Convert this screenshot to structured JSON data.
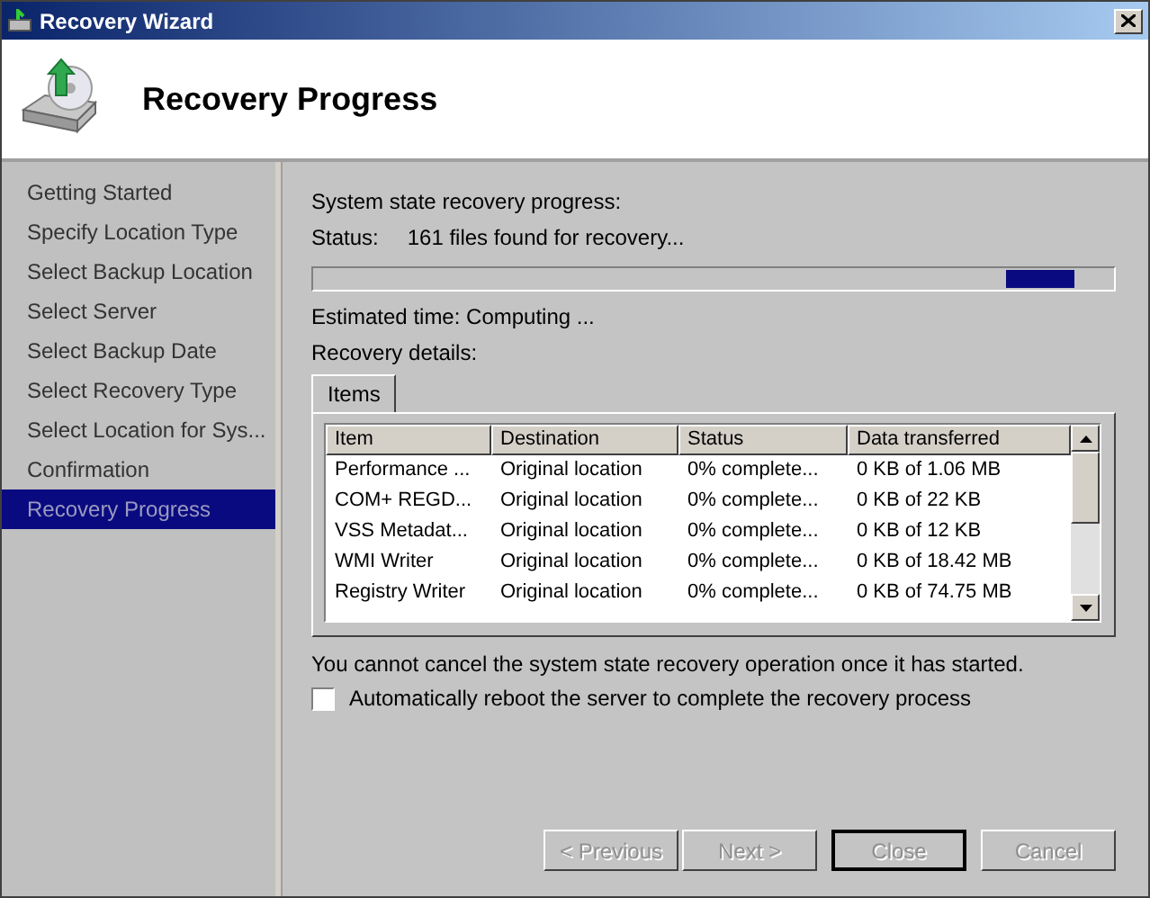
{
  "window": {
    "title": "Recovery Wizard"
  },
  "header": {
    "title": "Recovery Progress"
  },
  "sidebar": {
    "items": [
      {
        "label": "Getting Started",
        "selected": false
      },
      {
        "label": "Specify Location Type",
        "selected": false
      },
      {
        "label": "Select Backup Location",
        "selected": false
      },
      {
        "label": "Select Server",
        "selected": false
      },
      {
        "label": "Select Backup Date",
        "selected": false
      },
      {
        "label": "Select Recovery Type",
        "selected": false
      },
      {
        "label": "Select Location for Sys...",
        "selected": false
      },
      {
        "label": "Confirmation",
        "selected": false
      },
      {
        "label": "Recovery Progress",
        "selected": true
      }
    ]
  },
  "progress": {
    "heading": "System state recovery progress:",
    "status_label": "Status:",
    "status_value": "161 files found for recovery...",
    "estimated": "Estimated time: Computing ...",
    "details_label": "Recovery details:",
    "level": 0.95
  },
  "tabs": [
    {
      "label": "Items",
      "selected": true
    }
  ],
  "table": {
    "columns": [
      "Item",
      "Destination",
      "Status",
      "Data transferred"
    ],
    "rows": [
      [
        "Performance ...",
        "Original location",
        "0% complete...",
        "0 KB of 1.06 MB"
      ],
      [
        "COM+ REGD...",
        "Original location",
        "0% complete...",
        "0 KB of 22 KB"
      ],
      [
        "VSS Metadat...",
        "Original location",
        "0% complete...",
        "0 KB of 12 KB"
      ],
      [
        "WMI Writer",
        "Original location",
        "0% complete...",
        "0 KB of 18.42 MB"
      ],
      [
        "Registry Writer",
        "Original location",
        "0% complete...",
        "0 KB of 74.75 MB"
      ]
    ]
  },
  "note": "You cannot cancel the system state recovery operation once it has started.",
  "reboot_checkbox": {
    "label": "Automatically reboot the server to complete the recovery process",
    "checked": false
  },
  "buttons": [
    {
      "label": "< Previous",
      "disabled": true,
      "default": false
    },
    {
      "label": "Next >",
      "disabled": true,
      "default": false
    },
    {
      "label": "Close",
      "disabled": true,
      "default": true
    },
    {
      "label": "Cancel",
      "disabled": true,
      "default": false
    }
  ]
}
